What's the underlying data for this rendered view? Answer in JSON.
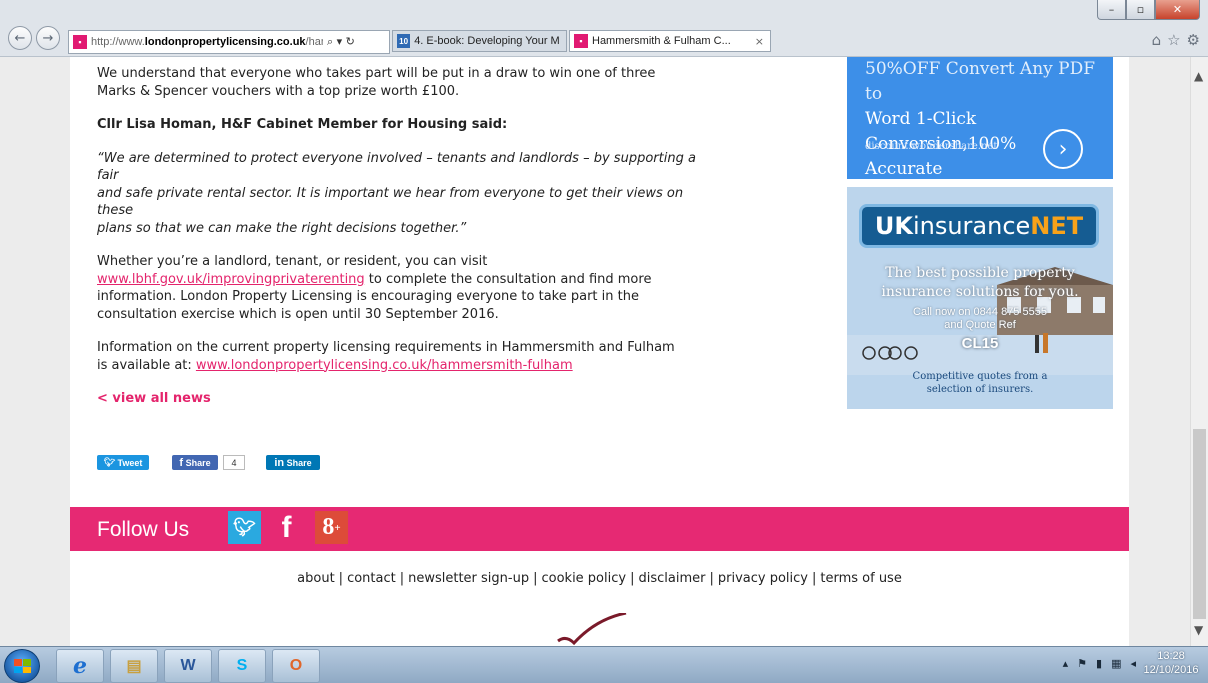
{
  "browser": {
    "address_prefix": "http://www.",
    "address_domain": "londonpropertylicensing.co.uk",
    "address_rest": "/hammersı",
    "address_controls": "⌕ ▾ ↻",
    "tabs": [
      {
        "label": "4. E-book: Developing Your M...",
        "icon_text": "10"
      },
      {
        "label": "Hammersmith & Fulham C...",
        "close": "×"
      }
    ],
    "window_buttons": {
      "minimize": "–",
      "maximize": "▫",
      "close": "✕"
    }
  },
  "article": {
    "lead_line1": "We understand that everyone who takes part will be put in a draw to win one of three",
    "lead_line2": "Marks & Spencer vouchers with a top prize worth £100.",
    "heading": "Cllr Lisa Homan, H&F Cabinet Member for Housing said:",
    "quote_line1": "“We are determined to protect everyone involved – tenants and landlords – by supporting a fair",
    "quote_line2": "and safe private rental sector. It is important we hear from everyone to get their views on these",
    "quote_line3": "plans so that we can make the right decisions together.”",
    "para3_line1": "Whether you’re a landlord, tenant, or resident, you can visit",
    "para3_link": "www.lbhf.gov.uk/improvingprivaterenting",
    "para3_after_link": " to complete the consultation and find more",
    "para3_line3": "information. London Property Licensing is encouraging everyone to take part in the",
    "para3_line4": "consultation exercise which is open until 30 September 2016.",
    "para4_line1": "Information on the current property licensing requirements in Hammersmith and Fulham",
    "para4_prefix": "is available at: ",
    "para4_link": "www.londonpropertylicensing.co.uk/hammersmith-fulham",
    "view_all": "< view all news"
  },
  "share": {
    "tweet": "Tweet",
    "fb_share": "Share",
    "fb_count": "4",
    "li_share": "Share"
  },
  "footer": {
    "follow_us": "Follow Us",
    "links": [
      "about",
      "contact",
      "newsletter sign-up",
      "cookie policy",
      "disclaimer",
      "privacy policy",
      "terms of use"
    ],
    "separator": "|"
  },
  "ads": {
    "pdf": {
      "line1": "50%OFF Convert Any PDF to",
      "line2": "Word 1-Click Conversion,100%",
      "line3": "Accurate",
      "domain": "discount.wondershare.net"
    },
    "insurance": {
      "brand_uk": "UK",
      "brand_insurance": "insurance",
      "brand_net": "NET",
      "tagline1": "The best possible property",
      "tagline2": "insurance solutions for you.",
      "call": "Call now on 0844 875 5555",
      "quote_ref": "and Quote Ref",
      "ref_code": "CL15",
      "competitive1": "Competitive quotes from a",
      "competitive2": "selection of insurers."
    }
  },
  "taskbar": {
    "time": "13:28",
    "date": "12/10/2016"
  },
  "colors": {
    "brand_pink": "#e62973",
    "link_pink": "#e4246c",
    "ad_blue": "#3d8fe8"
  }
}
